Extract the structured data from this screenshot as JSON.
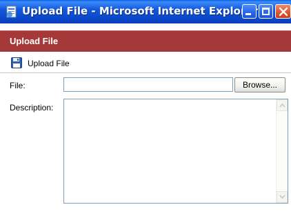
{
  "window": {
    "title": "Upload File - Microsoft Internet Explorer",
    "icon": "ie-page-icon",
    "controls": [
      "minimize-icon",
      "maximize-icon",
      "close-icon"
    ]
  },
  "header": {
    "title": "Upload File",
    "background": "#a5393a"
  },
  "toolbar": {
    "upload_label": "Upload File",
    "upload_icon": "floppy-disk-icon"
  },
  "form": {
    "file_label": "File:",
    "file_value": "",
    "browse_label": "Browse...",
    "description_label": "Description:",
    "description_value": ""
  },
  "colors": {
    "titlebar_blue": "#0b46c8",
    "header_red": "#a5393a",
    "input_border": "#7f9db9"
  }
}
